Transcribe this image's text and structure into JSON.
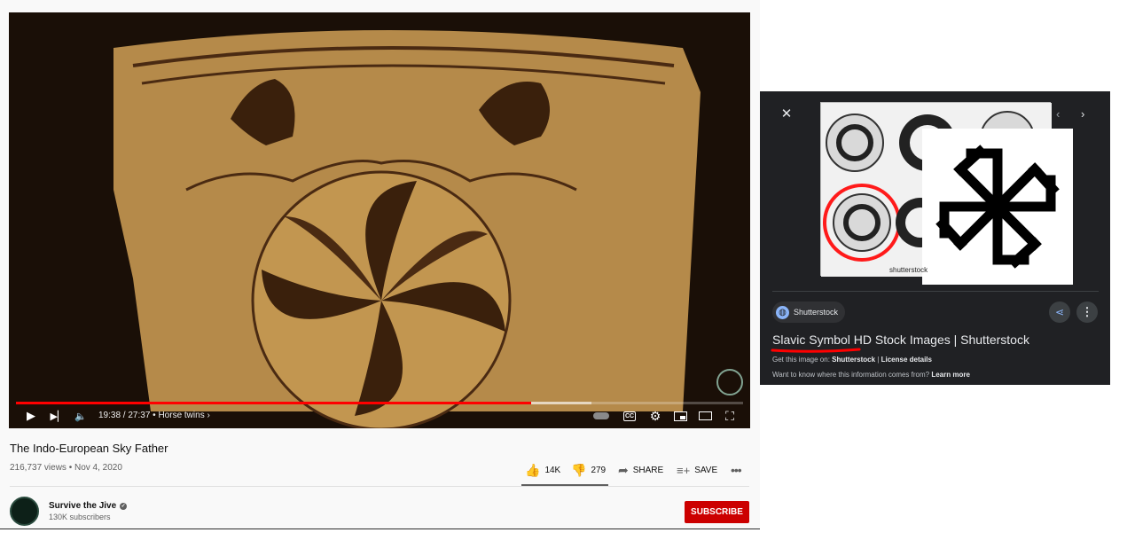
{
  "player": {
    "time": "19:38 / 27:37",
    "chapter": "Horse twins",
    "progress": 0.709,
    "buffered": 0.791,
    "cc_label": "CC"
  },
  "video": {
    "title": "The Indo-European Sky Father",
    "stats": "216,737 views • Nov 4, 2020",
    "likes": "14K",
    "dislikes": "279",
    "share_label": "SHARE",
    "save_label": "SAVE"
  },
  "channel": {
    "name": "Survive the Jive",
    "subscribers": "130K subscribers",
    "subscribe_label": "SUBSCRIBE"
  },
  "google_panel": {
    "source": "Shutterstock",
    "title": "Slavic Symbol HD Stock Images | Shutterstock",
    "get_image_prefix": "Get this image on:",
    "get_image_source": "Shutterstock",
    "separator": "|",
    "license_label": "License details",
    "why_text": "Want to know where this information comes from?",
    "learn_more": "Learn more",
    "image_credit": "shutterstock"
  },
  "colors": {
    "accent_red": "#ff0000",
    "subscribe_red": "#cc0000",
    "panel_bg": "#202124",
    "link_blue": "#8ab4f8"
  },
  "icons": [
    "play-icon",
    "next-icon",
    "volume-icon",
    "chevron-right-icon",
    "autoplay-toggle-icon",
    "cc-icon",
    "settings-icon",
    "miniplayer-icon",
    "theater-icon",
    "fullscreen-icon",
    "thumbs-up-icon",
    "thumbs-down-icon",
    "share-icon",
    "save-playlist-icon",
    "more-icon",
    "verified-icon",
    "close-icon",
    "chevron-left-icon",
    "globe-icon",
    "share-alt-icon",
    "more-vert-icon"
  ]
}
